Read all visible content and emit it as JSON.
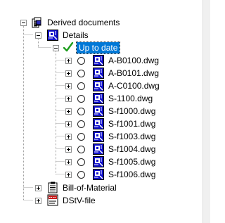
{
  "tree": {
    "root": {
      "label": "Derived documents",
      "icon": "document-stack-icon"
    },
    "details": {
      "label": "Details",
      "icon": "drawing-sheet-icon"
    },
    "status": {
      "label": "Up to date",
      "icon": "checkmark-icon",
      "accent": "#0078d7",
      "check_color": "#1e9e1e"
    },
    "files": [
      {
        "label": "A-B0100.dwg"
      },
      {
        "label": "A-B0101.dwg"
      },
      {
        "label": "A-C0100.dwg"
      },
      {
        "label": "S-1100.dwg"
      },
      {
        "label": "S-f1000.dwg"
      },
      {
        "label": "S-f1001.dwg"
      },
      {
        "label": "S-f1003.dwg"
      },
      {
        "label": "S-f1004.dwg"
      },
      {
        "label": "S-f1005.dwg"
      },
      {
        "label": "S-f1006.dwg"
      }
    ],
    "bom": {
      "label": "Bill-of-Material",
      "icon": "clipboard-list-icon"
    },
    "dstv": {
      "label": "DStV-file",
      "icon": "dstv-file-icon"
    }
  }
}
